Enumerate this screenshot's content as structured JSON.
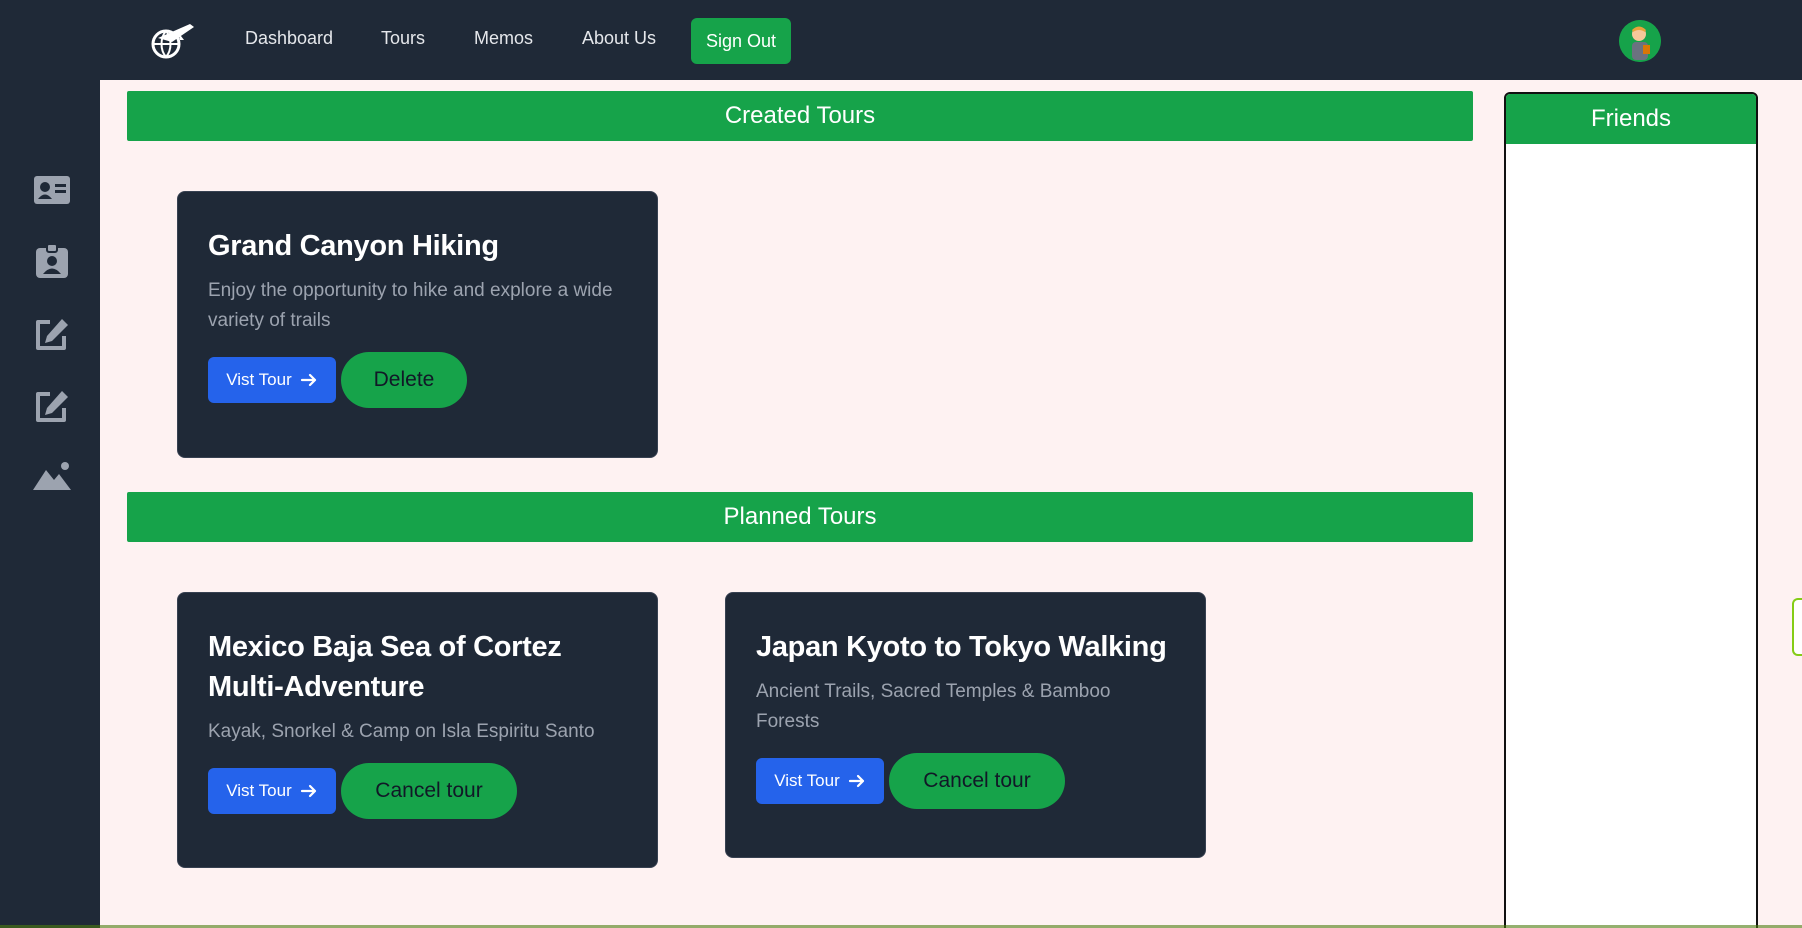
{
  "nav": {
    "links": [
      "Dashboard",
      "Tours",
      "Memos",
      "About Us"
    ],
    "signout": "Sign Out",
    "logo_icon": "airplane-globe-icon",
    "avatar_icon": "user-avatar-icon"
  },
  "sidebar": {
    "icons": [
      "id-card-icon",
      "id-badge-icon",
      "edit-icon",
      "edit-icon",
      "mountain-icon"
    ]
  },
  "sections": {
    "created_title": "Created Tours",
    "planned_title": "Planned Tours"
  },
  "created_tours": [
    {
      "title": "Grand Canyon Hiking",
      "description": "Enjoy the opportunity to hike and explore a wide variety of trails",
      "visit_label": "Vist Tour",
      "action_label": "Delete"
    }
  ],
  "planned_tours": [
    {
      "title": "Mexico Baja Sea of Cortez Multi-Adventure",
      "description": "Kayak, Snorkel & Camp on Isla Espiritu Santo",
      "visit_label": "Vist Tour",
      "action_label": "Cancel tour"
    },
    {
      "title": "Japan Kyoto to Tokyo Walking",
      "description": "Ancient Trails, Sacred Temples & Bamboo Forests",
      "visit_label": "Vist Tour",
      "action_label": "Cancel tour"
    }
  ],
  "friends": {
    "title": "Friends"
  },
  "colors": {
    "nav_bg": "#1f2937",
    "accent_green": "#16a34a",
    "button_blue": "#2563eb",
    "page_bg": "#fef2f2"
  }
}
